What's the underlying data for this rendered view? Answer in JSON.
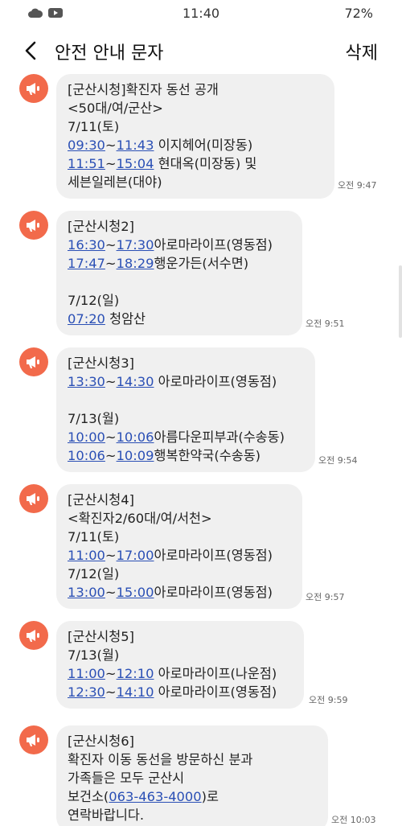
{
  "status_bar": {
    "time": "11:40",
    "battery": "72%"
  },
  "header": {
    "title": "안전 안내 문자",
    "delete_label": "삭제"
  },
  "messages": [
    {
      "time": "오전 9:47",
      "lines": [
        [
          {
            "t": "[군산시청]확진자 동선 공개"
          }
        ],
        [
          {
            "t": "<50대/여/군산>"
          }
        ],
        [
          {
            "t": "7/11(토)"
          }
        ],
        [
          {
            "t": "09:30",
            "link": true
          },
          {
            "t": "~"
          },
          {
            "t": "11:43",
            "link": true
          },
          {
            "t": " 이지헤어(미장동)"
          }
        ],
        [
          {
            "t": "11:51",
            "link": true
          },
          {
            "t": "~"
          },
          {
            "t": "15:04",
            "link": true
          },
          {
            "t": " 현대옥(미장동) 및"
          }
        ],
        [
          {
            "t": "세븐일레븐(대야)"
          }
        ]
      ]
    },
    {
      "time": "오전 9:51",
      "lines": [
        [
          {
            "t": "[군산시청2]"
          }
        ],
        [
          {
            "t": "16:30",
            "link": true
          },
          {
            "t": "~"
          },
          {
            "t": "17:30",
            "link": true
          },
          {
            "t": "아로마라이프(영동점)"
          }
        ],
        [
          {
            "t": "17:47",
            "link": true
          },
          {
            "t": "~"
          },
          {
            "t": "18:29",
            "link": true
          },
          {
            "t": "행운가든(서수면)"
          }
        ],
        [
          {
            "t": ""
          }
        ],
        [
          {
            "t": "7/12(일)"
          }
        ],
        [
          {
            "t": "07:20",
            "link": true
          },
          {
            "t": " 청암산"
          }
        ]
      ]
    },
    {
      "time": "오전 9:54",
      "lines": [
        [
          {
            "t": "[군산시청3]"
          }
        ],
        [
          {
            "t": "13:30",
            "link": true
          },
          {
            "t": "~"
          },
          {
            "t": "14:30",
            "link": true
          },
          {
            "t": " 아로마라이프(영동점)"
          }
        ],
        [
          {
            "t": ""
          }
        ],
        [
          {
            "t": "7/13(월)"
          }
        ],
        [
          {
            "t": "10:00",
            "link": true
          },
          {
            "t": "~"
          },
          {
            "t": "10:06",
            "link": true
          },
          {
            "t": "아름다운피부과(수송동)"
          }
        ],
        [
          {
            "t": "10:06",
            "link": true
          },
          {
            "t": "~"
          },
          {
            "t": "10:09",
            "link": true
          },
          {
            "t": "행복한약국(수송동)"
          }
        ]
      ]
    },
    {
      "time": "오전 9:57",
      "lines": [
        [
          {
            "t": "[군산시청4]"
          }
        ],
        [
          {
            "t": "<확진자2/60대/여/서천>"
          }
        ],
        [
          {
            "t": "7/11(토)"
          }
        ],
        [
          {
            "t": "11:00",
            "link": true
          },
          {
            "t": "~"
          },
          {
            "t": "17:00",
            "link": true
          },
          {
            "t": "아로마라이프(영동점)"
          }
        ],
        [
          {
            "t": "7/12(일)"
          }
        ],
        [
          {
            "t": "13:00",
            "link": true
          },
          {
            "t": "~"
          },
          {
            "t": "15:00",
            "link": true
          },
          {
            "t": "아로마라이프(영동점)"
          }
        ]
      ]
    },
    {
      "time": "오전 9:59",
      "lines": [
        [
          {
            "t": "[군산시청5]"
          }
        ],
        [
          {
            "t": "7/13(월)"
          }
        ],
        [
          {
            "t": "11:00",
            "link": true
          },
          {
            "t": "~"
          },
          {
            "t": "12:10",
            "link": true
          },
          {
            "t": " 아로마라이프(나운점)"
          }
        ],
        [
          {
            "t": "12:30",
            "link": true
          },
          {
            "t": "~"
          },
          {
            "t": "14:10",
            "link": true
          },
          {
            "t": " 아로마라이프(영동점)"
          }
        ]
      ]
    },
    {
      "time": "오전 10:03",
      "lines": [
        [
          {
            "t": "[군산시청6]"
          }
        ],
        [
          {
            "t": "확진자 이동 동선을 방문하신 분과"
          }
        ],
        [
          {
            "t": "가족들은 모두 군산시"
          }
        ],
        [
          {
            "t": "보건소("
          },
          {
            "t": "063-463-4000",
            "link": true
          },
          {
            "t": ")로"
          }
        ],
        [
          {
            "t": "연락바랍니다."
          }
        ]
      ]
    }
  ]
}
